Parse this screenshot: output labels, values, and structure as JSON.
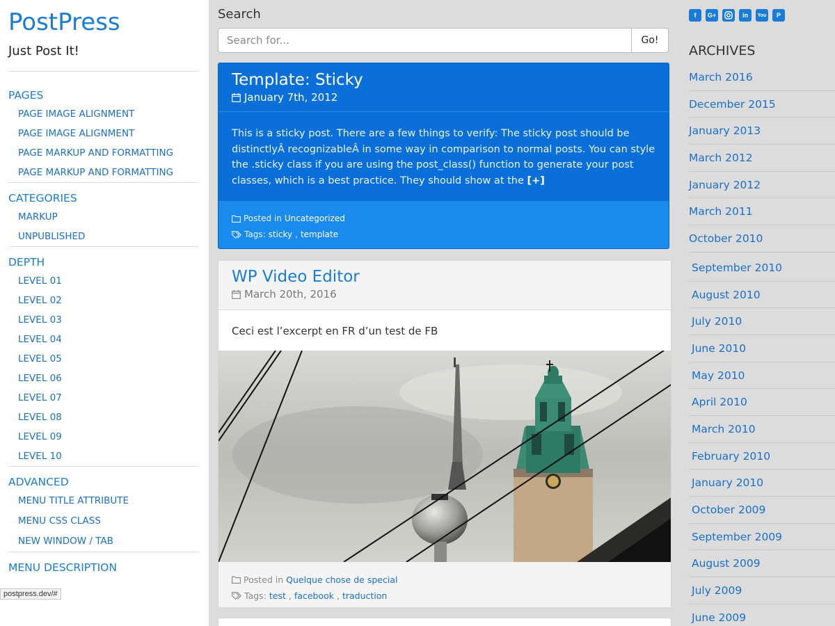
{
  "site": {
    "title": "PostPress",
    "tagline": "Just Post It!"
  },
  "menu": [
    {
      "heading": "PAGES",
      "items": [
        "PAGE IMAGE ALIGNMENT",
        "PAGE IMAGE ALIGNMENT",
        "PAGE MARKUP AND FORMATTING",
        "PAGE MARKUP AND FORMATTING"
      ]
    },
    {
      "heading": "CATEGORIES",
      "items": [
        "MARKUP",
        "UNPUBLISHED"
      ]
    },
    {
      "heading": "DEPTH",
      "items": [
        "LEVEL 01",
        "LEVEL 02",
        "LEVEL 03",
        "LEVEL 04",
        "LEVEL 05",
        "LEVEL 06",
        "LEVEL 07",
        "LEVEL 08",
        "LEVEL 09",
        "LEVEL 10"
      ]
    },
    {
      "heading": "ADVANCED",
      "items": [
        "MENU TITLE ATTRIBUTE",
        "MENU CSS CLASS",
        "NEW WINDOW / TAB"
      ]
    },
    {
      "heading": "MENU DESCRIPTION",
      "items": []
    }
  ],
  "status_bar": "postpress.dev/#",
  "search": {
    "label": "Search",
    "placeholder": "Search for...",
    "button": "Go!"
  },
  "sticky_post": {
    "title": "Template: Sticky",
    "date": "January 7th, 2012",
    "excerpt": "This is a sticky post. There are a few things to verify: The sticky post should be distinctlyÂ recognizableÂ in some way in comparison to normal posts. You can style the .sticky class if you are using the post_class() function to generate your post classes, which is a best practice. They should show at the",
    "more": "[+]",
    "posted_in_label": "Posted in",
    "category": "Uncategorized",
    "tags_label": "Tags:",
    "tags": [
      "sticky",
      "template"
    ]
  },
  "post": {
    "title": "WP Video Editor",
    "date": "March 20th, 2016",
    "excerpt": "Ceci est l’excerpt en FR d’un test de FB",
    "posted_in_label": "Posted in",
    "category": "Quelque chose de special",
    "tags_label": "Tags:",
    "tags": [
      "test",
      "facebook",
      "traduction"
    ]
  },
  "social_icons": [
    "facebook-icon",
    "google-plus-icon",
    "instagram-icon",
    "linkedin-icon",
    "youtube-icon",
    "pinterest-icon"
  ],
  "archives": {
    "title": "ARCHIVES",
    "items": [
      "March 2016",
      "December 2015",
      "January 2013",
      "March 2012",
      "January 2012",
      "March 2011",
      "October 2010",
      "September 2010",
      "August 2010",
      "July 2010",
      "June 2010",
      "May 2010",
      "April 2010",
      "March 2010",
      "February 2010",
      "January 2010",
      "October 2009",
      "September 2009",
      "August 2009",
      "July 2009",
      "June 2009"
    ]
  },
  "colors": {
    "accent": "#1a7cd6",
    "sticky_bg": "#0a6fd8",
    "sticky_footer": "#1a8aef",
    "page_bg": "#dcdcdc"
  }
}
